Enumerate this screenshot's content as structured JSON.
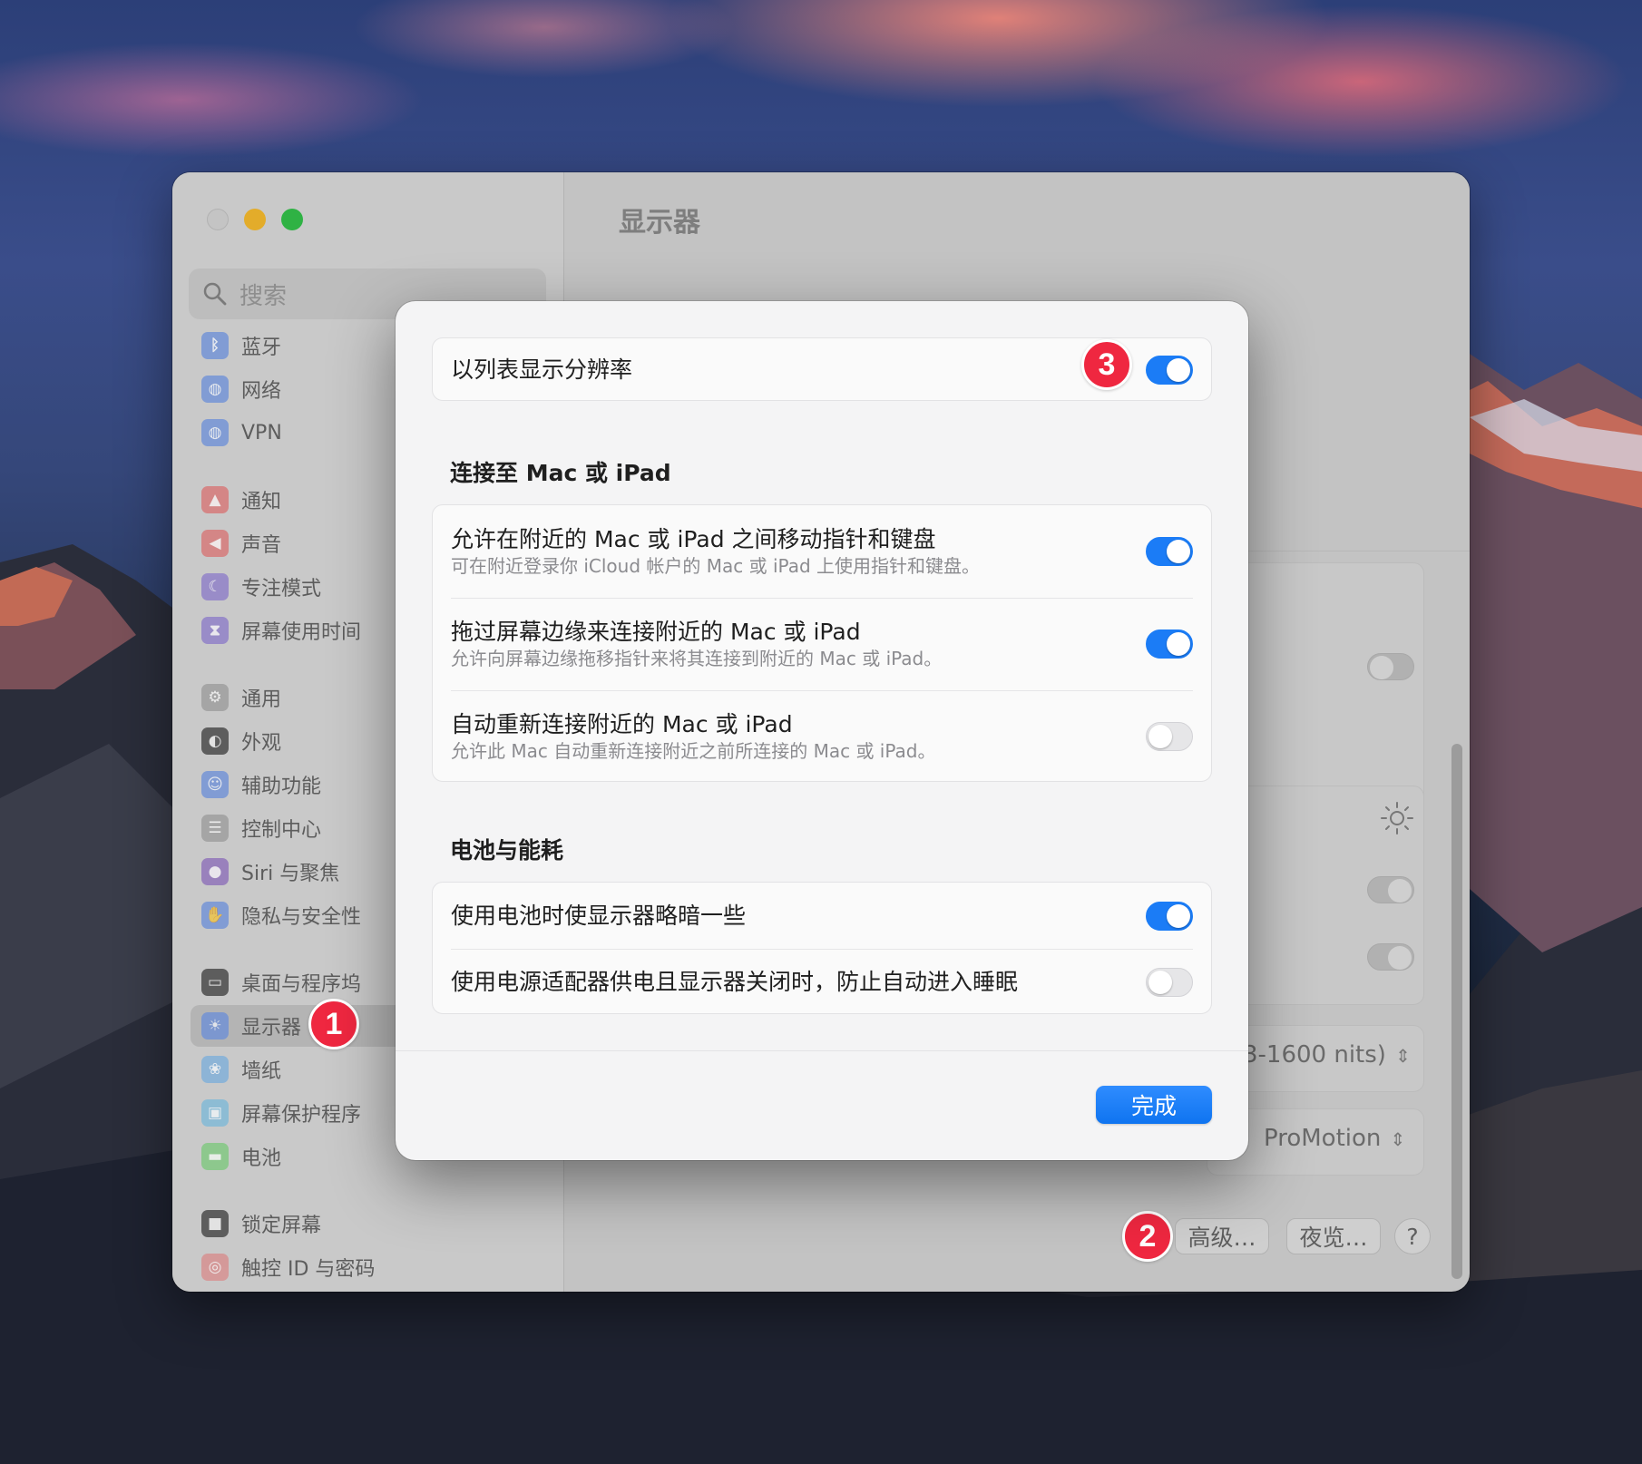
{
  "sidebar": {
    "search_placeholder": "搜索",
    "items": [
      {
        "label": "蓝牙",
        "icon": "bluetooth-icon",
        "color": "#6a8ed8"
      },
      {
        "label": "网络",
        "icon": "globe-icon",
        "color": "#6a8ed8"
      },
      {
        "label": "VPN",
        "icon": "vpn-icon",
        "color": "#6a8ed8"
      },
      {
        "label": "通知",
        "icon": "bell-icon",
        "color": "#d87070"
      },
      {
        "label": "声音",
        "icon": "speaker-icon",
        "color": "#d87070"
      },
      {
        "label": "专注模式",
        "icon": "moon-icon",
        "color": "#8a78c8"
      },
      {
        "label": "屏幕使用时间",
        "icon": "hourglass-icon",
        "color": "#8a78c8"
      },
      {
        "label": "通用",
        "icon": "gear-icon",
        "color": "#9a9a9a"
      },
      {
        "label": "外观",
        "icon": "appearance-icon",
        "color": "#3a3a3a"
      },
      {
        "label": "辅助功能",
        "icon": "accessibility-icon",
        "color": "#6a8ed8"
      },
      {
        "label": "控制中心",
        "icon": "control-center-icon",
        "color": "#9a9a9a"
      },
      {
        "label": "Siri 与聚焦",
        "icon": "siri-icon",
        "color": "#8a6ab8"
      },
      {
        "label": "隐私与安全性",
        "icon": "hand-icon",
        "color": "#6a8ed8"
      },
      {
        "label": "桌面与程序坞",
        "icon": "dock-icon",
        "color": "#3a3a3a"
      },
      {
        "label": "显示器",
        "icon": "sun-icon",
        "color": "#6a8ed8"
      },
      {
        "label": "墙纸",
        "icon": "wallpaper-icon",
        "color": "#7aaedb"
      },
      {
        "label": "屏幕保护程序",
        "icon": "screensaver-icon",
        "color": "#7ab8d8"
      },
      {
        "label": "电池",
        "icon": "battery-icon",
        "color": "#7ac87a"
      },
      {
        "label": "锁定屏幕",
        "icon": "lock-icon",
        "color": "#3a3a3a"
      },
      {
        "label": "触控 ID 与密码",
        "icon": "fingerprint-icon",
        "color": "#d88a8a"
      }
    ]
  },
  "main": {
    "title": "显示器",
    "preset_value": "3-1600 nits)",
    "refresh_value": "ProMotion",
    "advanced_button": "高级…",
    "night_shift_button": "夜览…",
    "help_button": "?"
  },
  "badges": {
    "one": "1",
    "two": "2",
    "three": "3"
  },
  "sheet": {
    "resolution_list": {
      "label": "以列表显示分辨率",
      "on": true
    },
    "connect_section": {
      "heading": "连接至 Mac 或 iPad",
      "rows": [
        {
          "title": "允许在附近的 Mac 或 iPad 之间移动指针和键盘",
          "subtitle": "可在附近登录你 iCloud 帐户的 Mac 或 iPad 上使用指针和键盘。",
          "on": true
        },
        {
          "title": "拖过屏幕边缘来连接附近的 Mac 或 iPad",
          "subtitle": "允许向屏幕边缘拖移指针来将其连接到附近的 Mac 或 iPad。",
          "on": true
        },
        {
          "title": "自动重新连接附近的 Mac 或 iPad",
          "subtitle": "允许此 Mac 自动重新连接附近之前所连接的 Mac 或 iPad。",
          "on": false
        }
      ]
    },
    "battery_section": {
      "heading": "电池与能耗",
      "rows": [
        {
          "title": "使用电池时使显示器略暗一些",
          "on": true
        },
        {
          "title": "使用电源适配器供电且显示器关闭时，防止自动进入睡眠",
          "on": false
        }
      ]
    },
    "done_button": "完成"
  },
  "colors": {
    "accent": "#1b7cf6",
    "badge": "#ef2740",
    "sheet_bg": "#f4f4f5"
  }
}
